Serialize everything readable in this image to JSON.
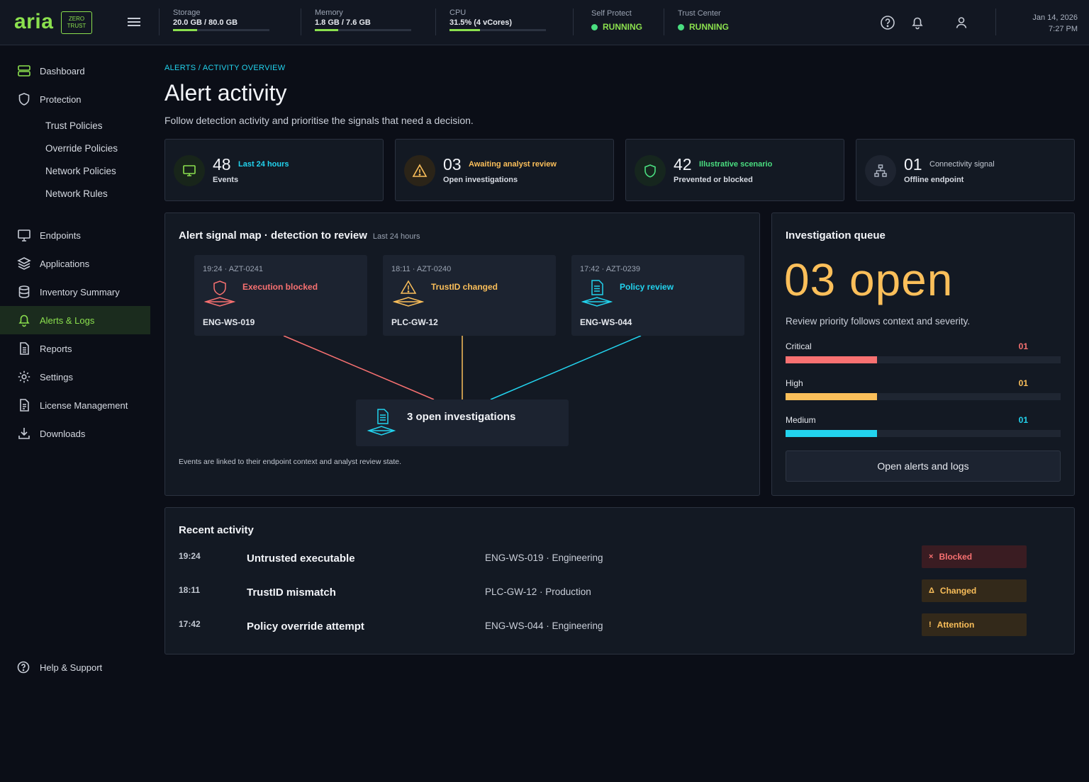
{
  "brand": {
    "name": "aria",
    "badge_line1": "ZERO",
    "badge_line2": "TRUST"
  },
  "topbar": {
    "storage": {
      "label": "Storage",
      "value": "20.0 GB / 80.0 GB",
      "fraction": 0.25
    },
    "memory": {
      "label": "Memory",
      "value": "1.8 GB / 7.6 GB",
      "fraction": 0.24
    },
    "cpu": {
      "label": "CPU",
      "value": "31.5% (4 vCores)",
      "fraction": 0.315
    },
    "self_protect": {
      "label": "Self Protect",
      "value": "RUNNING"
    },
    "trust_center": {
      "label": "Trust Center",
      "value": "RUNNING"
    },
    "date": "Jan 14, 2026",
    "time": "7:27 PM",
    "icons": [
      "help-icon",
      "bell-icon",
      "user-icon"
    ]
  },
  "sidebar": {
    "dashboard": "Dashboard",
    "protection": "Protection",
    "trust_policies": "Trust Policies",
    "override_policies": "Override Policies",
    "network_policies": "Network Policies",
    "network_rules": "Network Rules",
    "endpoints": "Endpoints",
    "applications": "Applications",
    "inventory_summary": "Inventory Summary",
    "alerts_logs": "Alerts & Logs",
    "reports": "Reports",
    "settings": "Settings",
    "license_management": "License Management",
    "downloads": "Downloads",
    "help_support": "Help & Support"
  },
  "page": {
    "breadcrumb": "ALERTS / ACTIVITY OVERVIEW",
    "title": "Alert activity",
    "subtitle": "Follow detection activity and prioritise the signals that need a decision."
  },
  "stats": [
    {
      "value": "48",
      "tag": "Last 24 hours",
      "caption": "Events",
      "icon": "monitor-icon",
      "color": "#8be04e"
    },
    {
      "value": "03",
      "tag": "Awaiting analyst review",
      "caption": "Open investigations",
      "icon": "warning-icon",
      "color": "#fbbf5a"
    },
    {
      "value": "42",
      "tag": "Illustrative scenario",
      "caption": "Prevented or blocked",
      "icon": "shield-icon",
      "color": "#4ade80"
    },
    {
      "value": "01",
      "tag": "Connectivity signal",
      "caption": "Offline endpoint",
      "icon": "network-icon",
      "color": "#aab2c0"
    }
  ],
  "signal_map": {
    "title": "Alert signal map · detection to review",
    "period": "Last 24 hours",
    "nodes": [
      {
        "meta": "19:24 · AZT-0241",
        "label": "Execution blocked",
        "host": "ENG-WS-019",
        "color": "#f87171"
      },
      {
        "meta": "18:11 · AZT-0240",
        "label": "TrustID changed",
        "host": "PLC-GW-12",
        "color": "#fbbf5a"
      },
      {
        "meta": "17:42 · AZT-0239",
        "label": "Policy review",
        "host": "ENG-WS-044",
        "color": "#22d3ee"
      }
    ],
    "center": "3 open investigations",
    "footer": "Events are linked to their endpoint context and analyst review state."
  },
  "queue": {
    "title": "Investigation queue",
    "big": "03 open",
    "desc": "Review priority follows context and severity.",
    "severities": [
      {
        "name": "Critical",
        "count": "01",
        "fraction": 0.333,
        "color": "#f87171"
      },
      {
        "name": "High",
        "count": "01",
        "fraction": 0.333,
        "color": "#fbbf5a"
      },
      {
        "name": "Medium",
        "count": "01",
        "fraction": 0.333,
        "color": "#22d3ee"
      }
    ],
    "button": "Open alerts and logs"
  },
  "recent": {
    "title": "Recent activity",
    "rows": [
      {
        "time": "19:24",
        "event": "Untrusted executable",
        "host": "ENG-WS-019 · Engineering",
        "mark": "×",
        "status": "Blocked",
        "color": "#f87171",
        "bg": "#3a1c22"
      },
      {
        "time": "18:11",
        "event": "TrustID mismatch",
        "host": "PLC-GW-12 · Production",
        "mark": "Δ",
        "status": "Changed",
        "color": "#fbbf5a",
        "bg": "#33291a"
      },
      {
        "time": "17:42",
        "event": "Policy override attempt",
        "host": "ENG-WS-044 · Engineering",
        "mark": "!",
        "status": "Attention",
        "color": "#fbbf5a",
        "bg": "#33291a"
      }
    ]
  }
}
